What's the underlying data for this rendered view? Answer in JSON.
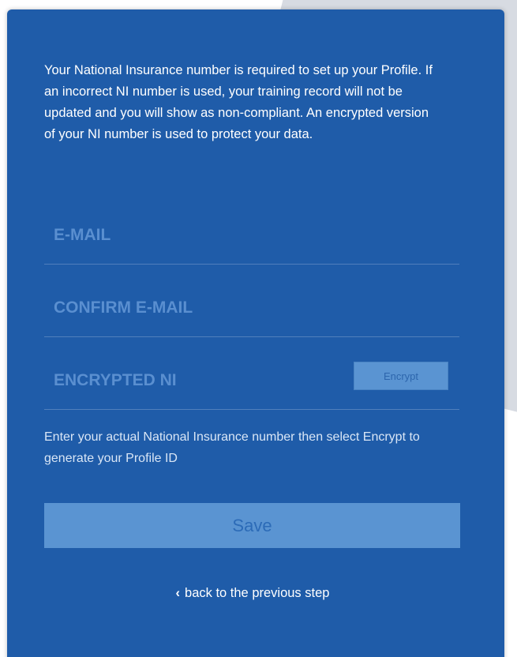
{
  "intro_text": "Your National Insurance number is required to set up your Profile. If an incorrect NI number is used, your training record will not be updated and you will show as non-compliant. An encrypted version of your NI number is used to protect your data.",
  "fields": {
    "email": {
      "placeholder": "E-MAIL",
      "value": ""
    },
    "confirm_email": {
      "placeholder": "CONFIRM E-MAIL",
      "value": ""
    },
    "encrypted_ni": {
      "placeholder": "ENCRYPTED NI",
      "value": ""
    }
  },
  "encrypt_button_label": "Encrypt",
  "hint_text": "Enter your actual National Insurance number then select Encrypt to generate your Profile ID",
  "save_button_label": "Save",
  "back_link_label": "back to the previous step",
  "icons": {
    "back": "chevron-left-icon"
  },
  "colors": {
    "panel": "#1f5ca9",
    "button": "#5a94d2",
    "placeholder": "#5a8fd0"
  }
}
